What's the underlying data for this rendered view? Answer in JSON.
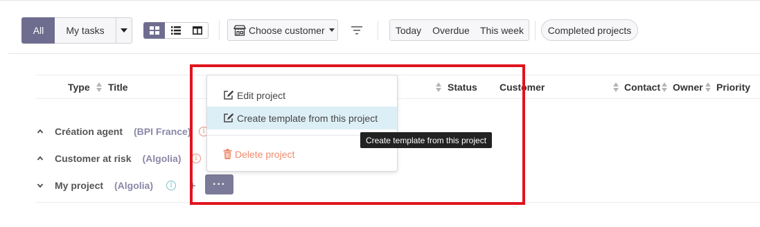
{
  "toolbar": {
    "scope": {
      "all": "All",
      "my_tasks": "My tasks"
    },
    "views": [
      "grid-view-icon",
      "list-view-icon",
      "split-view-icon"
    ],
    "customer_filter": "Choose customer",
    "quick_filters": [
      "Today",
      "Overdue",
      "This week"
    ],
    "completed_projects": "Completed projects"
  },
  "table": {
    "headers": {
      "type": "Type",
      "title": "Title",
      "status": "Status",
      "customer": "Customer",
      "contact": "Contact",
      "owner": "Owner",
      "priority": "Priority"
    },
    "groups": [
      {
        "name": "Création agent",
        "customer": "(BPI France)",
        "expanded": true,
        "info": "i"
      },
      {
        "name": "Customer at risk",
        "customer": "(Algolia)",
        "expanded": true,
        "info": "i"
      },
      {
        "name": "My project",
        "customer": "(Algolia)",
        "expanded": false,
        "info": "i"
      }
    ],
    "more_button": "···"
  },
  "context_menu": {
    "edit": "Edit project",
    "create_template": "Create template from this project",
    "delete": "Delete project"
  },
  "tooltip": "Create template from this project",
  "colors": {
    "accent": "#6f6d8f",
    "danger": "#ee8b6e",
    "highlight": "#ddeff6",
    "annotation": "#e0141e"
  }
}
